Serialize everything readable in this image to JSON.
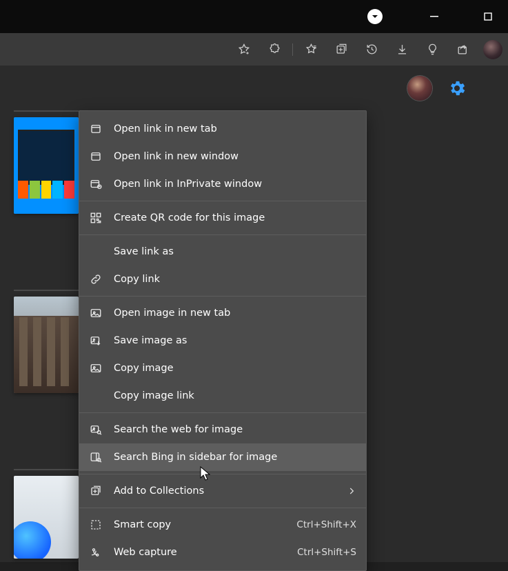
{
  "context_menu": {
    "items": [
      {
        "label": "Open link in new tab"
      },
      {
        "label": "Open link in new window"
      },
      {
        "label": "Open link in InPrivate window"
      },
      {
        "label": "Create QR code for this image"
      },
      {
        "label": "Save link as"
      },
      {
        "label": "Copy link"
      },
      {
        "label": "Open image in new tab"
      },
      {
        "label": "Save image as"
      },
      {
        "label": "Copy image"
      },
      {
        "label": "Copy image link"
      },
      {
        "label": "Search the web for image"
      },
      {
        "label": "Search Bing in sidebar for image"
      },
      {
        "label": "Add to Collections"
      },
      {
        "label": "Smart copy",
        "shortcut": "Ctrl+Shift+X"
      },
      {
        "label": "Web capture",
        "shortcut": "Ctrl+Shift+S"
      }
    ]
  }
}
